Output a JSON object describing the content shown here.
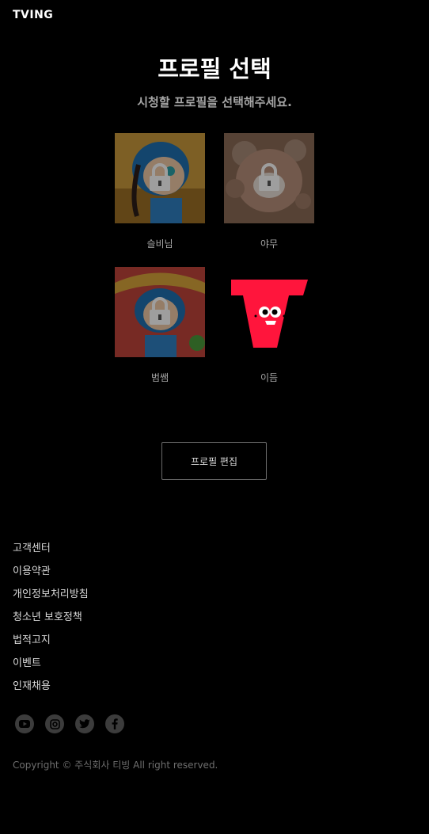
{
  "header": {
    "logo": "TVING"
  },
  "main": {
    "title": "프로필 선택",
    "subtitle": "시청할 프로필을 선택해주세요.",
    "profiles": [
      {
        "name": "슬비님",
        "locked": true,
        "bg": "#c99a3c",
        "accent": "#1e6fb0"
      },
      {
        "name": "야무",
        "locked": true,
        "bg": "#7a5a4a",
        "accent": "#b8907a"
      },
      {
        "name": "범쌤",
        "locked": true,
        "bg": "#c0443a",
        "accent": "#1e6fb0"
      },
      {
        "name": "이듬",
        "locked": false,
        "bg": "#000000",
        "accent": "#ff153c"
      }
    ],
    "edit_label": "프로필 편집"
  },
  "footer": {
    "links": [
      "고객센터",
      "이용약관",
      "개인정보처리방침",
      "청소년 보호정책",
      "법적고지",
      "이벤트",
      "인재채용"
    ],
    "social": [
      "youtube-icon",
      "instagram-icon",
      "twitter-icon",
      "facebook-icon"
    ],
    "copyright": "Copyright © 주식회사 티빙 All right reserved."
  },
  "colors": {
    "brand_red": "#ff153c",
    "subtle_text": "#a5a5a5"
  }
}
